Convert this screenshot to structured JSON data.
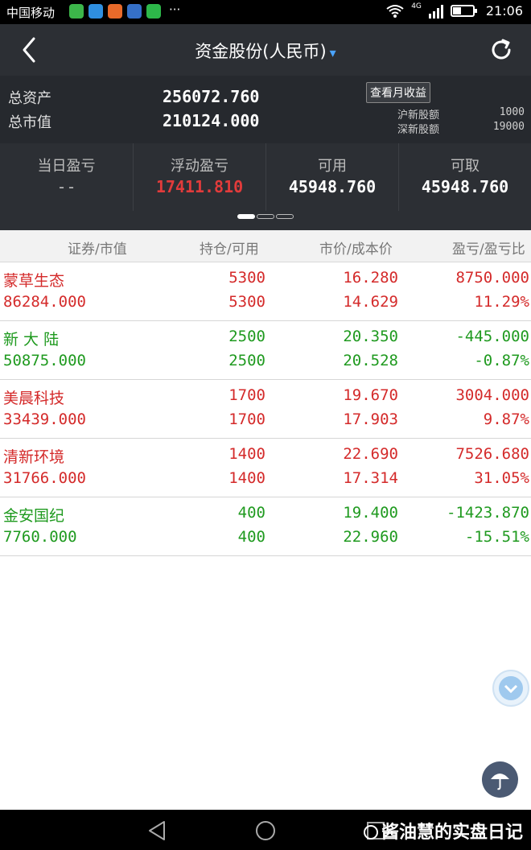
{
  "status_bar": {
    "carrier": "中国移动",
    "more": "···",
    "network": "4G",
    "time": "21:06"
  },
  "nav": {
    "title": "资金股份(人民币)",
    "title_chevron": "▾"
  },
  "summary": {
    "total_assets_label": "总资产",
    "total_assets_value": "256072.760",
    "market_value_label": "总市值",
    "market_value_value": "210124.000",
    "monthly_return_button": "查看月收益",
    "sh_quota_label": "沪新股额",
    "sh_quota_value": "1000",
    "sz_quota_label": "深新股额",
    "sz_quota_value": "19000"
  },
  "stats": [
    {
      "label": "当日盈亏",
      "value": "--",
      "style": "dash"
    },
    {
      "label": "浮动盈亏",
      "value": "17411.810",
      "style": "red"
    },
    {
      "label": "可用",
      "value": "45948.760",
      "style": "white"
    },
    {
      "label": "可取",
      "value": "45948.760",
      "style": "white"
    }
  ],
  "table": {
    "headers": [
      "证券/市值",
      "持仓/可用",
      "市价/成本价",
      "盈亏/盈亏比"
    ],
    "rows": [
      {
        "name": "蒙草生态",
        "market_value": "86284.000",
        "holding": "5300",
        "available": "5300",
        "price": "16.280",
        "cost": "14.629",
        "pl": "8750.000",
        "pl_ratio": "11.29%",
        "color": "red"
      },
      {
        "name": "新 大 陆",
        "market_value": "50875.000",
        "holding": "2500",
        "available": "2500",
        "price": "20.350",
        "cost": "20.528",
        "pl": "-445.000",
        "pl_ratio": "-0.87%",
        "color": "green"
      },
      {
        "name": "美晨科技",
        "market_value": "33439.000",
        "holding": "1700",
        "available": "1700",
        "price": "19.670",
        "cost": "17.903",
        "pl": "3004.000",
        "pl_ratio": "9.87%",
        "color": "red"
      },
      {
        "name": "清新环境",
        "market_value": "31766.000",
        "holding": "1400",
        "available": "1400",
        "price": "22.690",
        "cost": "17.314",
        "pl": "7526.680",
        "pl_ratio": "31.05%",
        "color": "red"
      },
      {
        "name": "金安国纪",
        "market_value": "7760.000",
        "holding": "400",
        "available": "400",
        "price": "19.400",
        "cost": "22.960",
        "pl": "-1423.870",
        "pl_ratio": "-15.51%",
        "color": "green"
      }
    ]
  },
  "watermark": "酱油慧的实盘日记"
}
